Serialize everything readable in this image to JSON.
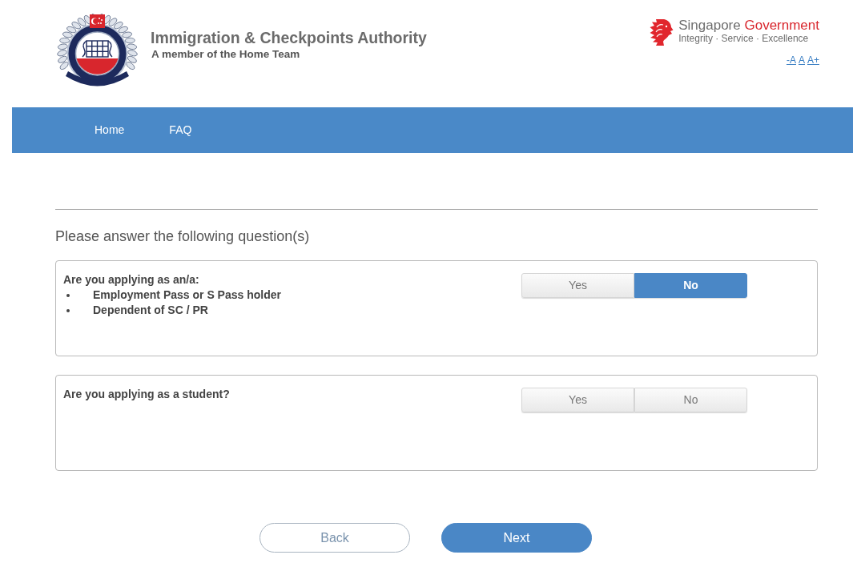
{
  "header": {
    "agency": {
      "name": "Immigration & Checkpoints Authority",
      "tagline": "A member of the Home Team"
    },
    "government": {
      "name_parts": [
        "Singapore",
        "Government"
      ],
      "motto": "Integrity · Service · Excellence"
    },
    "font_size_controls": [
      "-A",
      "A",
      "A+"
    ]
  },
  "nav": {
    "items": [
      "Home",
      "FAQ"
    ]
  },
  "form": {
    "heading": "Please answer the following question(s)",
    "questions": [
      {
        "text": "Are you applying as an/a:",
        "bullets": [
          "Employment Pass or S Pass holder",
          "Dependent of SC / PR"
        ],
        "options": [
          {
            "label": "Yes",
            "selected": false
          },
          {
            "label": "No",
            "selected": true
          }
        ]
      },
      {
        "text": "Are you applying as a student?",
        "options": [
          {
            "label": "Yes",
            "selected": false
          },
          {
            "label": "No",
            "selected": false
          }
        ]
      }
    ]
  },
  "actions": [
    {
      "label": "Back",
      "kind": "secondary"
    },
    {
      "label": "Next",
      "kind": "primary"
    }
  ]
}
